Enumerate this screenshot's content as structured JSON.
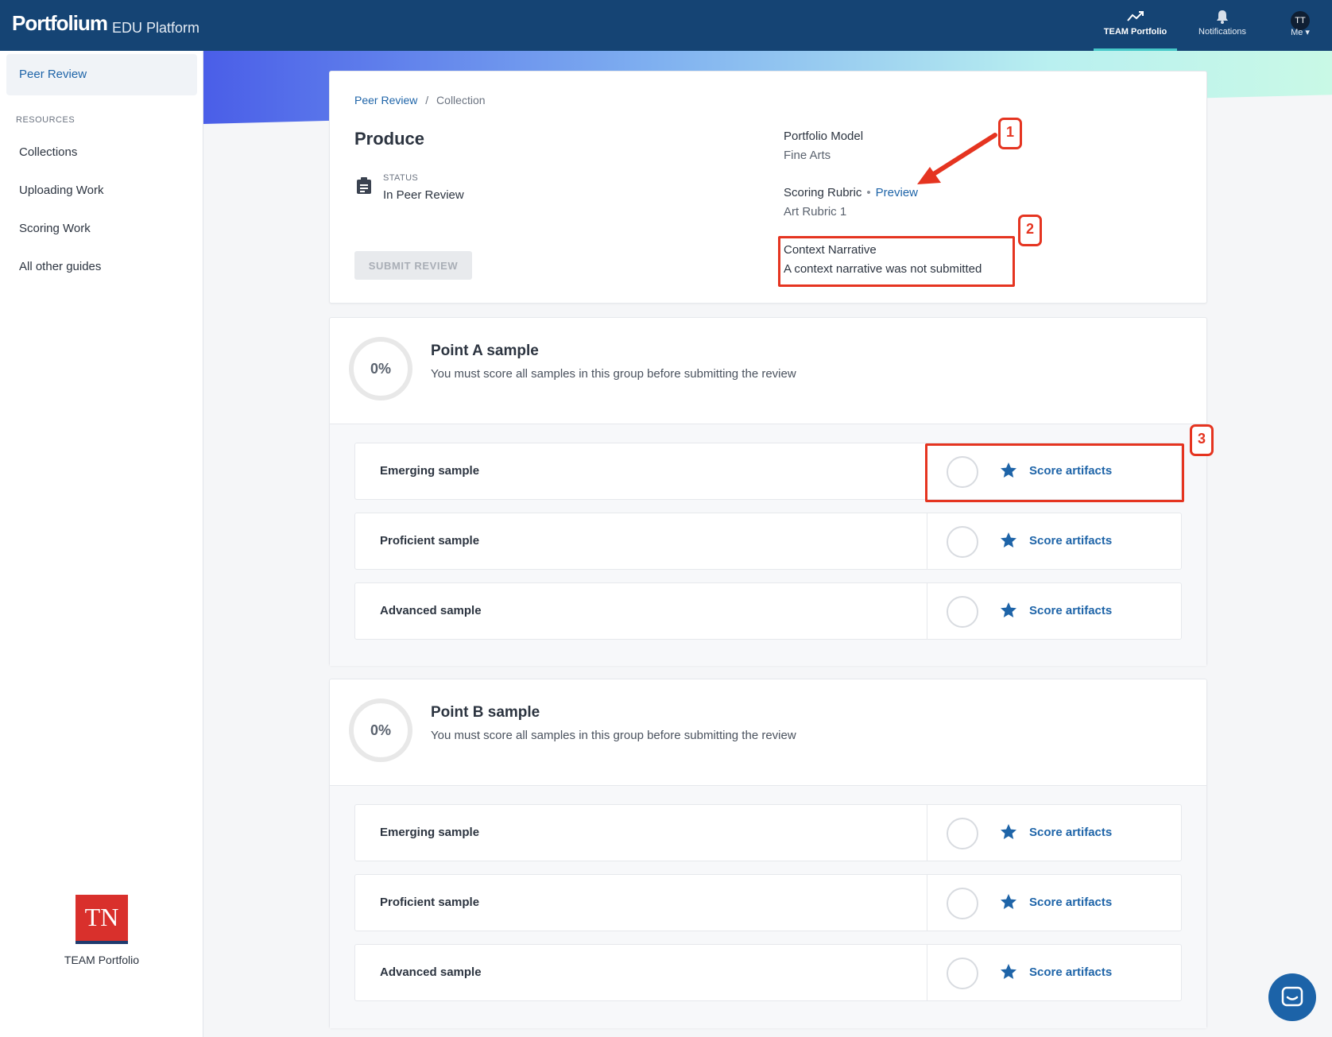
{
  "app": {
    "brand": "Portfolium",
    "brand_sub": "EDU Platform"
  },
  "topnav": {
    "team": {
      "label": "TEAM Portfolio",
      "icon": "trend-icon"
    },
    "notifications": {
      "label": "Notifications",
      "icon": "bell-icon"
    },
    "me": {
      "initials": "TT",
      "label": "Me ▾"
    }
  },
  "sidebar": {
    "active": "Peer Review",
    "section": "RESOURCES",
    "items": [
      "Collections",
      "Uploading Work",
      "Scoring Work",
      "All other guides"
    ],
    "logo_text": "TN",
    "logo_label": "TEAM Portfolio"
  },
  "header": {
    "breadcrumb": {
      "link": "Peer Review",
      "sep": "/",
      "current": "Collection"
    },
    "title": "Produce",
    "status_label": "STATUS",
    "status_value": "In Peer Review",
    "submit_label": "SUBMIT REVIEW",
    "portfolio_model_label": "Portfolio Model",
    "portfolio_model_value": "Fine Arts",
    "rubric_label": "Scoring Rubric",
    "rubric_dot": "•",
    "rubric_preview": "Preview",
    "rubric_value": "Art Rubric 1",
    "narrative_label": "Context Narrative",
    "narrative_value": "A context narrative was not submitted"
  },
  "annotations": [
    "1",
    "2",
    "3"
  ],
  "groups": [
    {
      "progress": "0%",
      "title": "Point A sample",
      "desc": "You must score all samples in this group before submitting the review",
      "rows": [
        {
          "name": "Emerging sample",
          "action": "Score artifacts"
        },
        {
          "name": "Proficient sample",
          "action": "Score artifacts"
        },
        {
          "name": "Advanced sample",
          "action": "Score artifacts"
        }
      ]
    },
    {
      "progress": "0%",
      "title": "Point B sample",
      "desc": "You must score all samples in this group before submitting the review",
      "rows": [
        {
          "name": "Emerging sample",
          "action": "Score artifacts"
        },
        {
          "name": "Proficient sample",
          "action": "Score artifacts"
        },
        {
          "name": "Advanced sample",
          "action": "Score artifacts"
        }
      ]
    }
  ],
  "colors": {
    "topbar": "#154474",
    "accent": "#1e64a8",
    "annotation": "#e53420"
  }
}
